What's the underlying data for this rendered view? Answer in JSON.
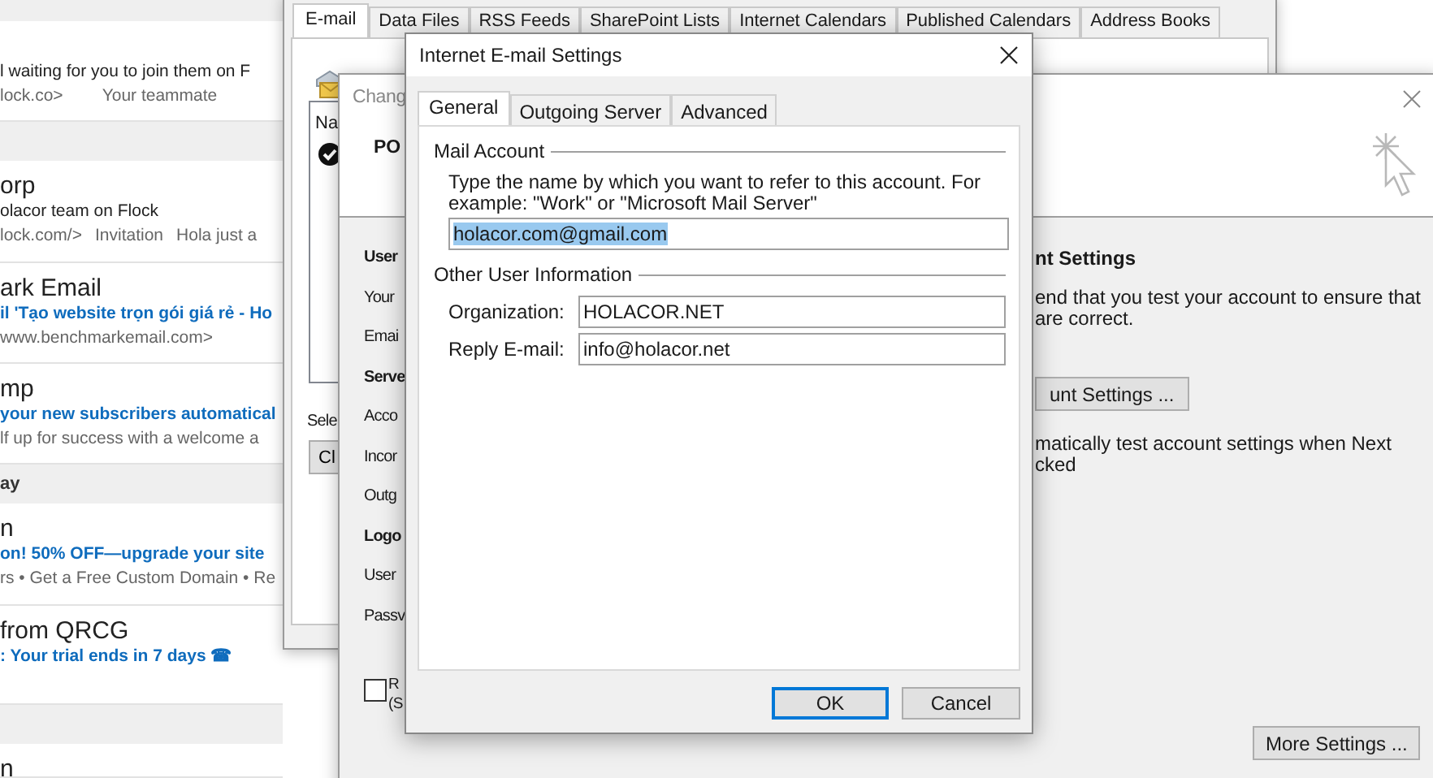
{
  "mail_list": {
    "items": [
      {
        "kind": "band"
      },
      {
        "kind": "message",
        "subject": "l waiting for you to join them on F",
        "unread": false,
        "preview": [
          "lock.co>",
          "Your teammate"
        ]
      },
      {
        "kind": "band"
      },
      {
        "kind": "message",
        "sender": "orp",
        "subject": "olacor team on Flock",
        "unread": false,
        "preview": [
          "lock.com/>",
          "Invitation",
          "Hola just a"
        ]
      },
      {
        "kind": "message",
        "sender": "ark Email",
        "subject": "il  'Tạo website trọn gói giá rẻ - Ho",
        "unread": true,
        "preview": [
          "www.benchmarkemail.com>"
        ]
      },
      {
        "kind": "message",
        "sender": "mp",
        "subject": "your new subscribers automatical",
        "unread": true,
        "preview": [
          "lf up for success with a welcome a"
        ]
      },
      {
        "kind": "band",
        "label": "ay"
      },
      {
        "kind": "message",
        "sender": "n",
        "subject": "on! 50% OFF—upgrade your site",
        "unread": true,
        "preview": [
          "rs • Get a Free Custom Domain • Re"
        ]
      },
      {
        "kind": "message",
        "sender": "from QRCG",
        "subject": ": Your trial ends in 7 days ☎",
        "unread": true
      },
      {
        "kind": "band"
      },
      {
        "kind": "message",
        "sender": "n"
      }
    ]
  },
  "account_settings": {
    "tabs": [
      {
        "label": "E-mail",
        "selected": true
      },
      {
        "label": "Data Files",
        "selected": false
      },
      {
        "label": "RSS Feeds",
        "selected": false
      },
      {
        "label": "SharePoint Lists",
        "selected": false
      },
      {
        "label": "Internet Calendars",
        "selected": false
      },
      {
        "label": "Published Calendars",
        "selected": false
      },
      {
        "label": "Address Books",
        "selected": false
      }
    ],
    "list_header": "Na",
    "select_label": "Sele",
    "button": "Cl"
  },
  "change_account": {
    "title": "Chang",
    "account_type": "PO",
    "left_labels": [
      {
        "text": "User",
        "kind": "heading"
      },
      {
        "text": "Your",
        "kind": "label"
      },
      {
        "text": "Emai",
        "kind": "label"
      },
      {
        "text": "Serve",
        "kind": "heading"
      },
      {
        "text": "Acco",
        "kind": "label"
      },
      {
        "text": "Incor",
        "kind": "label"
      },
      {
        "text": "Outg",
        "kind": "label"
      },
      {
        "text": "Logo",
        "kind": "heading"
      },
      {
        "text": "User",
        "kind": "label"
      },
      {
        "text": "Passv",
        "kind": "label"
      }
    ],
    "remember_checkbox": {
      "checked": false,
      "lines": [
        "R",
        "(S"
      ]
    },
    "test_heading": "nt Settings",
    "test_description": [
      "end that you test your account to ensure that",
      "are correct."
    ],
    "test_button": "unt Settings ...",
    "auto_test_lines": [
      "matically test account settings when Next",
      "cked"
    ],
    "more_settings_button": "More Settings ..."
  },
  "dialog": {
    "title": "Internet E-mail Settings",
    "tabs": [
      {
        "label": "General",
        "selected": true
      },
      {
        "label": "Outgoing Server",
        "selected": false
      },
      {
        "label": "Advanced",
        "selected": false
      }
    ],
    "mail_account": {
      "title": "Mail Account",
      "description": "Type the name by which you want to refer to this account. For example: \"Work\" or \"Microsoft Mail Server\"",
      "value": "holacor.com@gmail.com",
      "value_selected": true
    },
    "other_info": {
      "title": "Other User Information",
      "fields": [
        {
          "label": "Organization:",
          "value": "HOLACOR.NET"
        },
        {
          "label": "Reply E-mail:",
          "value": "info@holacor.net"
        }
      ]
    },
    "buttons": [
      {
        "label": "OK",
        "default": true
      },
      {
        "label": "Cancel",
        "default": false
      }
    ]
  }
}
